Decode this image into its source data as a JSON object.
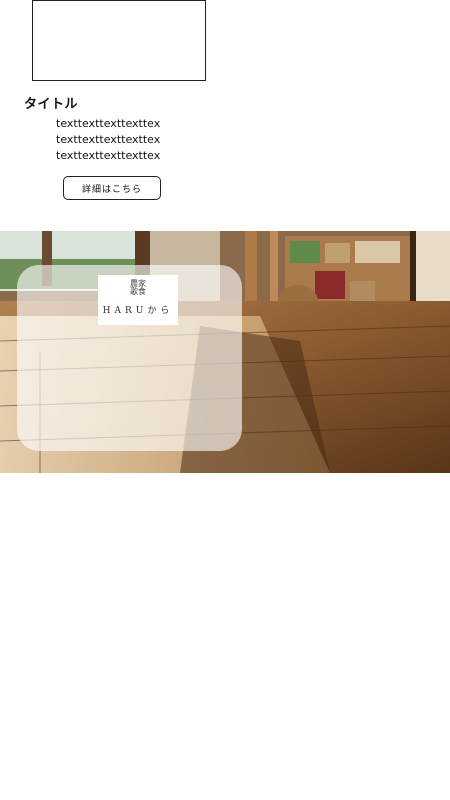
{
  "section": {
    "title": "タイトル",
    "lines": [
      "texttexttexttexttex",
      "texttexttexttexttex",
      "texttexttexttexttex"
    ],
    "details_label": "詳細はこちら"
  },
  "hero": {
    "logo_mark": "農家歌食",
    "logo_text": "HARUから"
  },
  "colors": {
    "floor": "#7a4f2c",
    "overlay": "#ffffff"
  }
}
